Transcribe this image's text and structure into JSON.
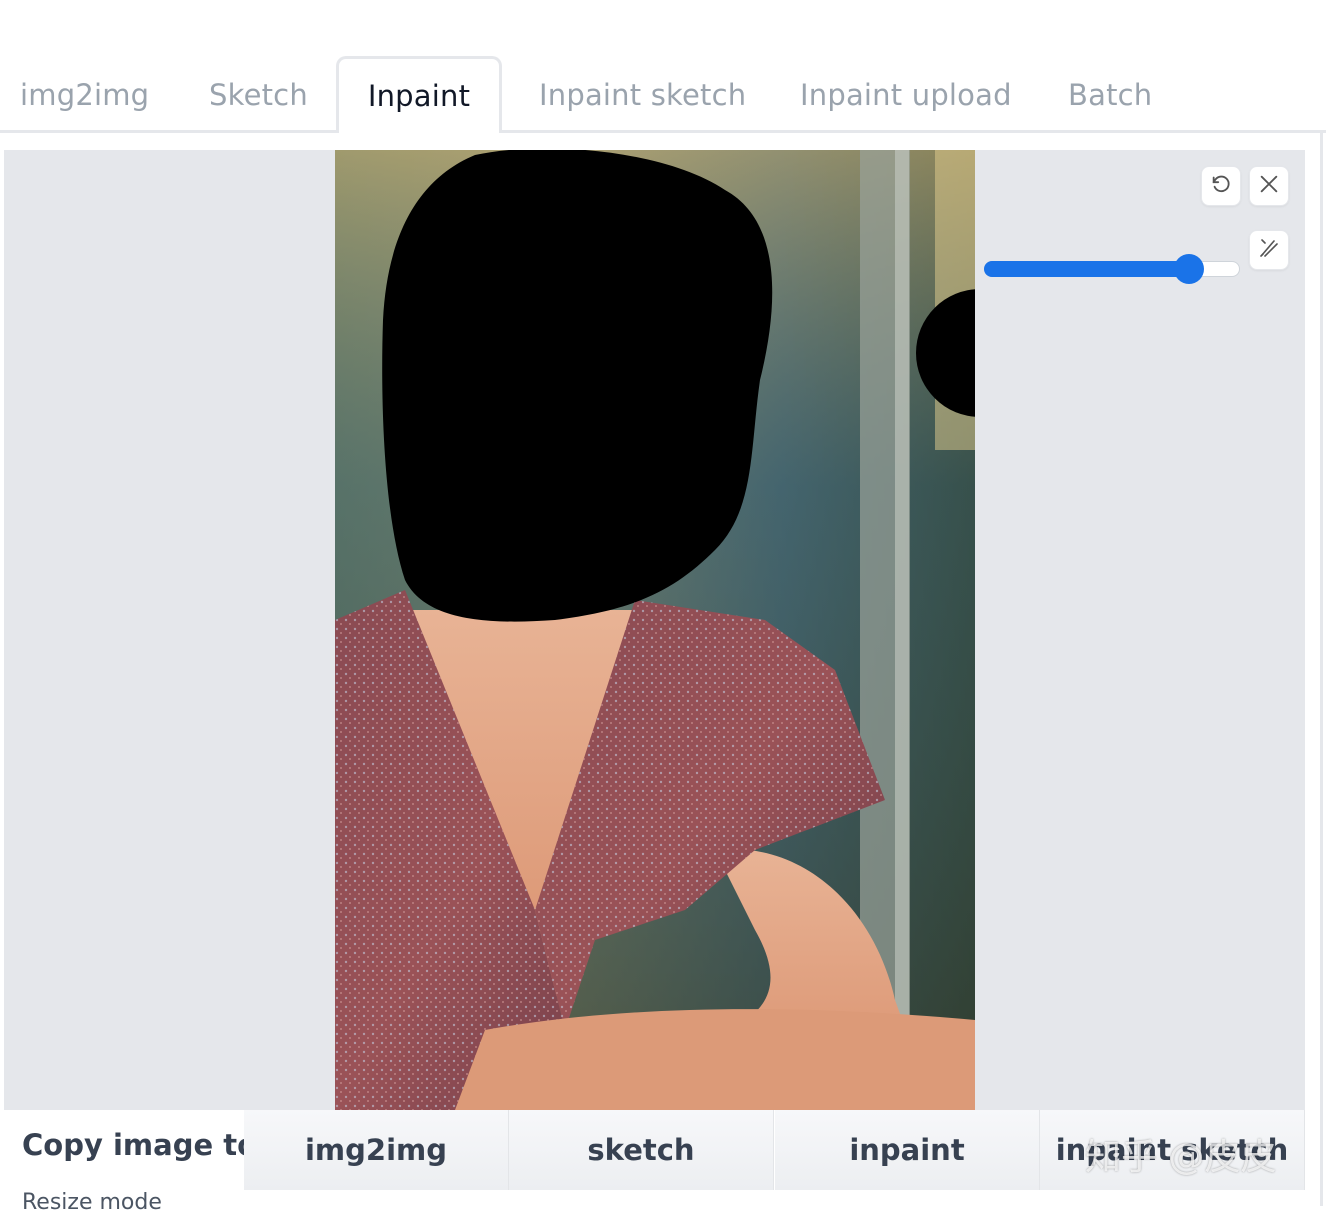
{
  "tabs": [
    {
      "label": "img2img",
      "active": false
    },
    {
      "label": "Sketch",
      "active": false
    },
    {
      "label": "Inpaint",
      "active": true
    },
    {
      "label": "Inpaint sketch",
      "active": false
    },
    {
      "label": "Inpaint upload",
      "active": false
    },
    {
      "label": "Batch",
      "active": false
    }
  ],
  "canvas": {
    "tools": {
      "undo_icon": "undo-icon",
      "clear_icon": "close-icon",
      "brush_icon": "brush-icon"
    },
    "brush_slider": {
      "value_fraction": 0.8,
      "color": "#1a73e8"
    }
  },
  "copy_row": {
    "label": "Copy image to:",
    "buttons": [
      {
        "label": "img2img"
      },
      {
        "label": "sketch"
      },
      {
        "label": "inpaint"
      },
      {
        "label": "inpaint sketch"
      }
    ]
  },
  "resize_mode_label": "Resize mode",
  "watermark": "知乎 @皮皮"
}
